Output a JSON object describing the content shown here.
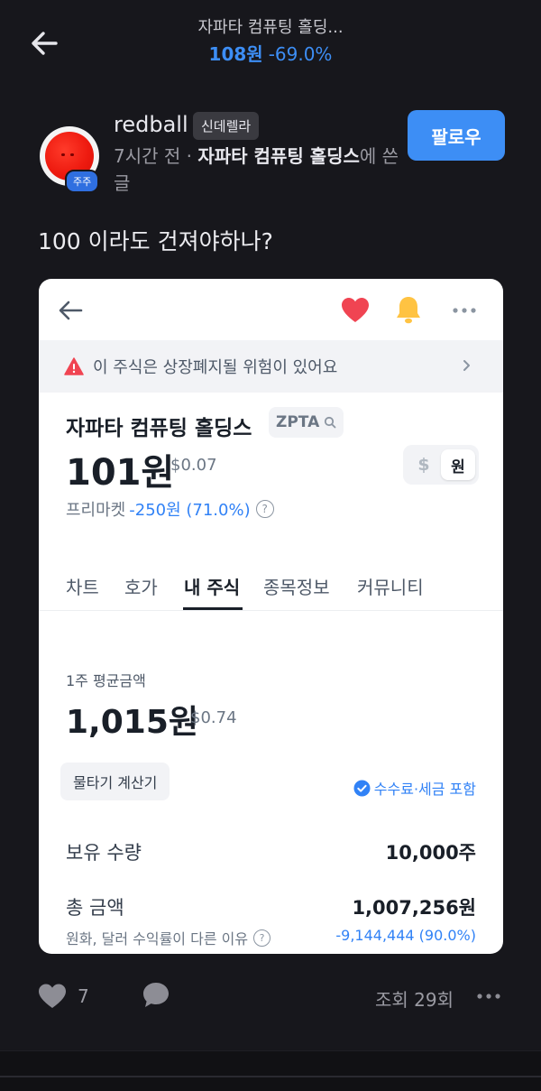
{
  "header": {
    "title": "자파타 컴퓨팅 홀딩...",
    "price": "108원",
    "change": "-69.0%"
  },
  "colors": {
    "accent": "#3d8ef5",
    "background": "#17171c",
    "heart": "#f04452",
    "bell": "#ffc342"
  },
  "author": {
    "username": "redball",
    "tier": "신데렐라",
    "avatar_badge": "주주",
    "time": "7시간 전",
    "separator": "·",
    "stock": "자파타 컴퓨팅 홀딩스",
    "suffix": "에 쓴 글",
    "follow_label": "팔로우"
  },
  "post": {
    "text": "100 이라도 건져야하나?"
  },
  "screenshot": {
    "icons": [
      "back-arrow-icon",
      "heart-icon",
      "bell-icon",
      "more-icon"
    ],
    "warning": "이 주식은 상장폐지될 위험이 있어요",
    "stock_name": "자파타 컴퓨팅 홀딩스",
    "ticker": "ZPTA",
    "price": "101원",
    "price_usd": "$0.07",
    "unit_usd": "$",
    "unit_krw": "원",
    "premarket_label": "프리마켓",
    "premarket_change": "-250원 (71.0%)",
    "tabs": [
      "차트",
      "호가",
      "내 주식",
      "종목정보",
      "커뮤니티"
    ],
    "active_tab": "내 주식",
    "avg_label": "1주 평균금액",
    "avg_price": "1,015원",
    "avg_usd": "$0.74",
    "calc_label": "물타기 계산기",
    "fee_note": "수수료·세금 포함",
    "holdings_label": "보유 수량",
    "holdings_value": "10,000주",
    "total_label": "총 금액",
    "total_value": "1,007,256원",
    "fx_note": "원화, 달러 수익률이 다른 이유",
    "pl_value": "-9,144,444 (90.0%)"
  },
  "actions": {
    "like_count": "7",
    "views": "조회 29회"
  }
}
